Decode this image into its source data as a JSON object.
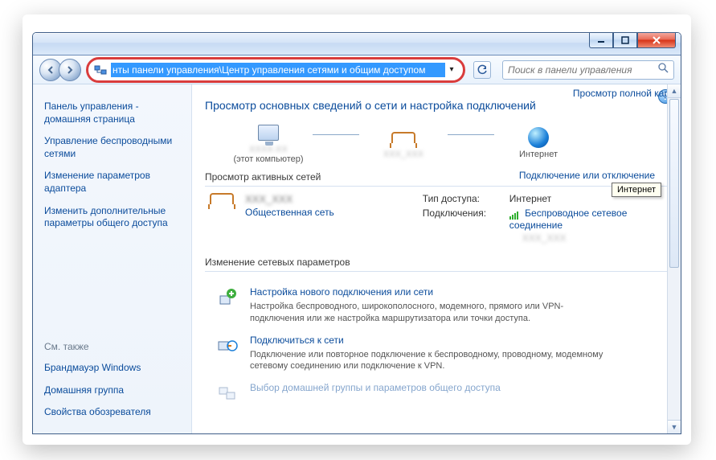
{
  "titlebar": {
    "min_tip": "Свернуть",
    "max_tip": "Развернуть",
    "close_tip": "Закрыть"
  },
  "nav": {
    "address_text": "нты панели управления\\Центр управления сетями и общим доступом",
    "search_placeholder": "Поиск в панели управления"
  },
  "sidebar": {
    "home": "Панель управления - домашняя страница",
    "links": [
      "Управление беспроводными сетями",
      "Изменение параметров адаптера",
      "Изменить дополнительные параметры общего доступа"
    ],
    "see_also_label": "См. также",
    "see_also": [
      "Брандмауэр Windows",
      "Домашняя группа",
      "Свойства обозревателя"
    ]
  },
  "main": {
    "title": "Просмотр основных сведений о сети и настройка подключений",
    "full_map": "Просмотр полной карты",
    "this_pc_sub": "(этот компьютер)",
    "internet_label": "Интернет",
    "tooltip": "Интернет",
    "active_label": "Просмотр активных сетей",
    "connect_disconnect": "Подключение или отключение",
    "active_net": {
      "type_link": "Общественная сеть",
      "access_label": "Тип доступа:",
      "access_value": "Интернет",
      "conn_label": "Подключения:",
      "conn_value": "Беспроводное сетевое соединение"
    },
    "change_label": "Изменение сетевых параметров",
    "tasks": [
      {
        "title": "Настройка нового подключения или сети",
        "desc": "Настройка беспроводного, широкополосного, модемного, прямого или VPN-подключения или же настройка маршрутизатора или точки доступа."
      },
      {
        "title": "Подключиться к сети",
        "desc": "Подключение или повторное подключение к беспроводному, проводному, модемному сетевому соединению или подключение к VPN."
      },
      {
        "title": "Выбор домашней группы и параметров общего доступа",
        "desc": ""
      }
    ]
  }
}
